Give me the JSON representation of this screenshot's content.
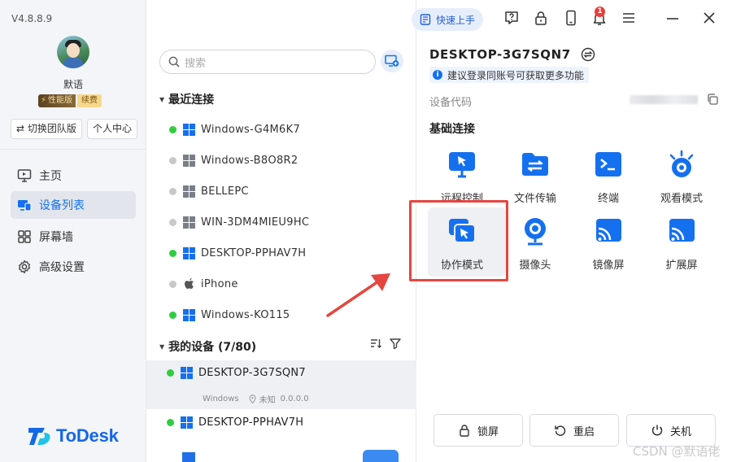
{
  "app": {
    "version": "V4.8.8.9",
    "brand": "ToDesk",
    "watermark": "CSDN @默语佬"
  },
  "user": {
    "name": "默语",
    "badge_level": "性能版",
    "badge_renew": "续费"
  },
  "sidebar": {
    "switch_team": "切换团队版",
    "personal_center": "个人中心",
    "items": [
      {
        "label": "主页",
        "icon": "monitor-icon",
        "active": false
      },
      {
        "label": "设备列表",
        "icon": "devices-icon",
        "active": true
      },
      {
        "label": "屏幕墙",
        "icon": "grid-icon",
        "active": false
      },
      {
        "label": "高级设置",
        "icon": "gear-icon",
        "active": false
      }
    ]
  },
  "search": {
    "placeholder": "搜索"
  },
  "recent": {
    "title": "最近连接",
    "devices": [
      {
        "name": "Windows-G4M6K7",
        "os": "windows",
        "online": true
      },
      {
        "name": "Windows-B8O8R2",
        "os": "windows",
        "online": false
      },
      {
        "name": "BELLEPC",
        "os": "windows",
        "online": false
      },
      {
        "name": "WIN-3DM4MIEU9HC",
        "os": "windows",
        "online": false
      },
      {
        "name": "DESKTOP-PPHAV7H",
        "os": "windows",
        "online": true
      },
      {
        "name": "iPhone",
        "os": "apple",
        "online": false
      },
      {
        "name": "Windows-KO115",
        "os": "windows",
        "online": true
      }
    ]
  },
  "my_devices": {
    "title": "我的设备 (7/80)",
    "selected": {
      "name": "DESKTOP-3G7SQN7",
      "os_label": "Windows",
      "location": "未知",
      "ip": "0.0.0.0"
    },
    "next": {
      "name": "DESKTOP-PPHAV7H"
    }
  },
  "topbar": {
    "quick_start": "快速上手",
    "notification_count": "1"
  },
  "detail": {
    "device_name": "DESKTOP-3G7SQN7",
    "tip": "建议登录同账号可获取更多功能",
    "code_label": "设备代码",
    "basic_title": "基础连接",
    "features_row1": [
      "远程控制",
      "文件传输",
      "终端",
      "观看模式"
    ],
    "features_row2": [
      "协作模式",
      "摄像头",
      "镜像屏",
      "扩展屏"
    ],
    "actions": {
      "lock": "锁屏",
      "restart": "重启",
      "shutdown": "关机"
    }
  },
  "colors": {
    "accent": "#1570ef",
    "online": "#2ecc40",
    "offline": "#c8c8c8",
    "highlight_border": "#e5463f",
    "badge": "#ee3b3b"
  }
}
